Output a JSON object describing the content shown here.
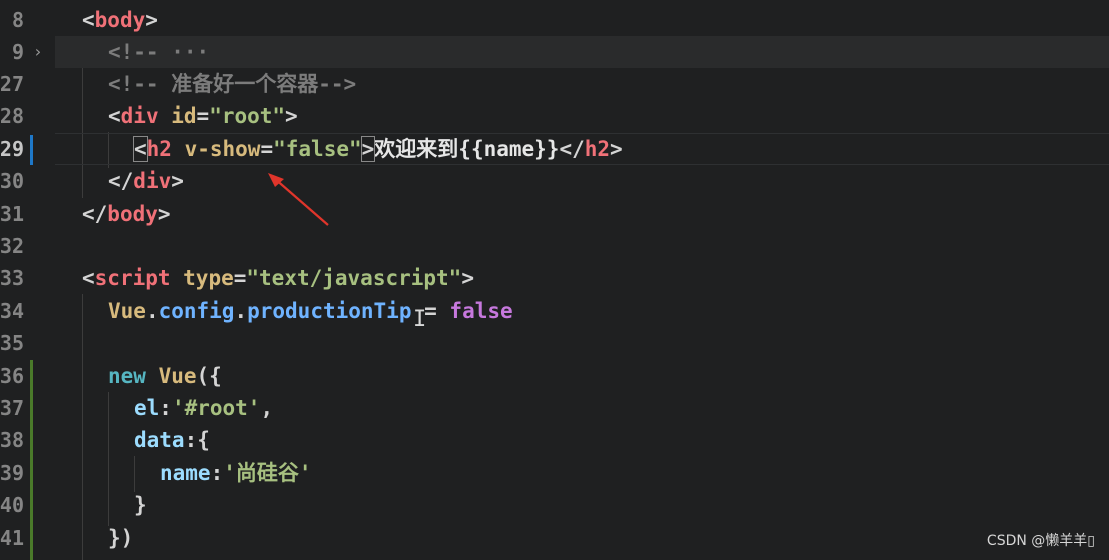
{
  "editor": {
    "lines": [
      {
        "num": "8"
      },
      {
        "num": "9"
      },
      {
        "num": "27"
      },
      {
        "num": "28"
      },
      {
        "num": "29"
      },
      {
        "num": "30"
      },
      {
        "num": "31"
      },
      {
        "num": "32"
      },
      {
        "num": "33"
      },
      {
        "num": "34"
      },
      {
        "num": "35"
      },
      {
        "num": "36"
      },
      {
        "num": "37"
      },
      {
        "num": "38"
      },
      {
        "num": "39"
      },
      {
        "num": "40"
      },
      {
        "num": "41"
      }
    ],
    "code": {
      "l8_open": "<",
      "l8_tag": "body",
      "l8_close": ">",
      "l9_comment": "<!-- ···",
      "l27_comment": "<!-- 准备好一个容器-->",
      "l28_open": "<",
      "l28_tag": "div",
      "l28_attr": " id",
      "l28_eq": "=",
      "l28_val": "\"root\"",
      "l28_close": ">",
      "l29_open": "<",
      "l29_tag": "h2",
      "l29_attr": " v-show",
      "l29_eq": "=",
      "l29_val": "\"false\"",
      "l29_close": ">",
      "l29_text": "欢迎来到{{name}}",
      "l29_end_open": "</",
      "l29_end_tag": "h2",
      "l29_end_close": ">",
      "l30_open": "</",
      "l30_tag": "div",
      "l30_close": ">",
      "l31_open": "</",
      "l31_tag": "body",
      "l31_close": ">",
      "l33_open": "<",
      "l33_tag": "script",
      "l33_attr": " type",
      "l33_eq": "=",
      "l33_val": "\"text/javascript\"",
      "l33_close": ">",
      "l34_obj": "Vue",
      "l34_dot1": ".",
      "l34_prop1": "config",
      "l34_dot2": ".",
      "l34_prop2": "productionTip",
      "l34_op": " = ",
      "l34_val": "false",
      "l36_kw": "new ",
      "l36_type": "Vue",
      "l36_punct": "({",
      "l37_key": "el",
      "l37_colon": ":",
      "l37_val": "'#root'",
      "l37_comma": ",",
      "l38_key": "data",
      "l38_punct": ":{",
      "l39_key": "name",
      "l39_colon": ":",
      "l39_val": "'尚硅谷'",
      "l40_punct": "}",
      "l41_punct": "})"
    }
  },
  "icons": {
    "fold": "chevron-right-icon",
    "arrow": "red-annotation-arrow",
    "cursor": "text-cursor-icon"
  },
  "colors": {
    "background": "#1f2021",
    "tag": "#f07178",
    "attribute": "#d7ba7d",
    "string": "#a7c080",
    "keyword": "#56b6c2",
    "annotation_arrow": "#e0352b",
    "git_modified": "#4a7a2a",
    "git_current": "#1e78c8"
  },
  "watermark": "CSDN @懒羊羊▯"
}
